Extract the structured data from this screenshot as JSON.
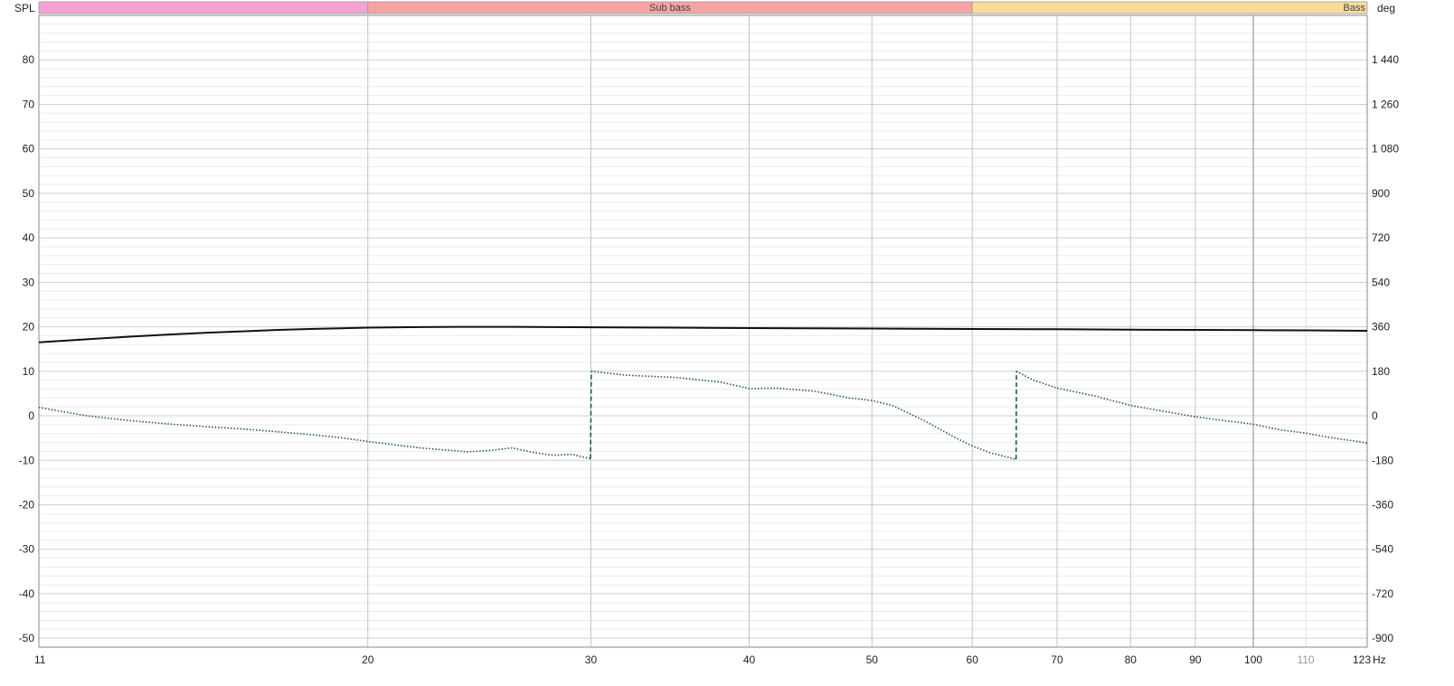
{
  "chart_data": {
    "type": "line",
    "left_axis_label": "SPL",
    "right_axis_label": "deg",
    "x_unit_label": "Hz",
    "x_scale": "log",
    "xlim": [
      11,
      123
    ],
    "ylim_left": [
      -52,
      90
    ],
    "ylim_right": [
      -936,
      1620
    ],
    "grid": true,
    "x_ticks": [
      11,
      20,
      30,
      40,
      50,
      60,
      70,
      80,
      90,
      100,
      110,
      123
    ],
    "x_tick_labels": [
      "11",
      "20",
      "30",
      "40",
      "50",
      "60",
      "70",
      "80",
      "90",
      "100",
      "110",
      "123"
    ],
    "x_major_gridlines": [
      20,
      30,
      40,
      50,
      60,
      70,
      80,
      90,
      100
    ],
    "x_minor_gridlines": [
      110
    ],
    "y_left_ticks": [
      80,
      70,
      60,
      50,
      40,
      30,
      20,
      10,
      0,
      -10,
      -20,
      -30,
      -40,
      -50
    ],
    "y_left_tick_labels": [
      "80",
      "70",
      "60",
      "50",
      "40",
      "30",
      "20",
      "10",
      "0",
      "-10",
      "-20",
      "-30",
      "-40",
      "-50"
    ],
    "y_right_ticks": [
      1440,
      1260,
      1080,
      900,
      720,
      540,
      360,
      180,
      0,
      -180,
      -360,
      -540,
      -720,
      -900
    ],
    "y_right_tick_labels": [
      "1 440",
      "1 260",
      "1 080",
      "900",
      "720",
      "540",
      "360",
      "180",
      "0",
      "-180",
      "-360",
      "-540",
      "-720",
      "-900"
    ],
    "bands": [
      {
        "label": "",
        "from": 11,
        "to": 20,
        "color": "#f4a3d6"
      },
      {
        "label": "Sub bass",
        "from": 20,
        "to": 60,
        "color": "#f5a3a3"
      },
      {
        "label": "Bass",
        "from": 60,
        "to": 123,
        "color": "#f8dc9a"
      }
    ],
    "series": [
      {
        "axis": "left",
        "color": "#111111",
        "style": "solid",
        "x": [
          11,
          12,
          13,
          14,
          15,
          16,
          17,
          18,
          20,
          22,
          24,
          26,
          28,
          30,
          35,
          40,
          45,
          50,
          55,
          60,
          70,
          80,
          90,
          100,
          110,
          123
        ],
        "y": [
          16.5,
          17.2,
          17.8,
          18.3,
          18.7,
          19.0,
          19.3,
          19.5,
          19.8,
          19.95,
          20.0,
          20.0,
          19.95,
          19.9,
          19.8,
          19.7,
          19.65,
          19.6,
          19.55,
          19.5,
          19.45,
          19.35,
          19.3,
          19.25,
          19.2,
          19.1
        ]
      },
      {
        "axis": "right",
        "color": "#1e5e3a",
        "style": "dotted",
        "x": [
          11,
          12,
          13,
          14,
          15,
          16,
          17,
          18,
          19,
          20,
          22,
          24,
          25,
          26,
          27,
          28,
          29,
          29.98,
          30.02,
          32,
          35,
          38,
          40,
          42,
          45,
          48,
          50,
          52,
          55,
          58,
          60,
          62,
          64.98,
          65.02,
          67,
          70,
          75,
          80,
          85,
          90,
          95,
          100,
          105,
          110,
          115,
          123
        ],
        "y": [
          34,
          0,
          -20,
          -34,
          -45,
          -54,
          -65,
          -76,
          -88,
          -104,
          -130,
          -146,
          -140,
          -130,
          -148,
          -160,
          -156,
          -174,
          180,
          164,
          155,
          136,
          110,
          112,
          100,
          72,
          62,
          40,
          -20,
          -85,
          -122,
          -150,
          -176,
          180,
          145,
          112,
          80,
          42,
          18,
          -4,
          -20,
          -34,
          -57,
          -70,
          -88,
          -110
        ]
      }
    ]
  }
}
